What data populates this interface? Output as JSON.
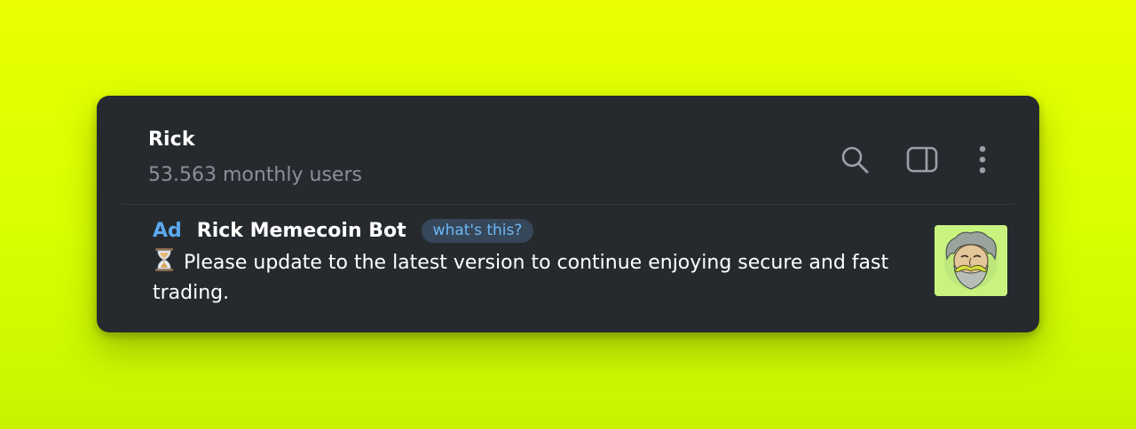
{
  "header": {
    "title": "Rick",
    "subtitle": "53.563 monthly users"
  },
  "toolbar": {
    "icons": [
      "search-icon",
      "side-panel-icon",
      "more-vertical-icon"
    ]
  },
  "ad": {
    "tag": "Ad",
    "name": "Rick Memecoin Bot",
    "whats_this": "what's this?",
    "icon": "hourglass-icon",
    "text": "Please update to the latest version to continue enjoying secure and fast trading.",
    "thumbnail": "rick-avatar"
  },
  "colors": {
    "background": "#e3ff00",
    "card": "#262a2f",
    "accent": "#5aa9f0",
    "muted_text": "#8a9097"
  }
}
